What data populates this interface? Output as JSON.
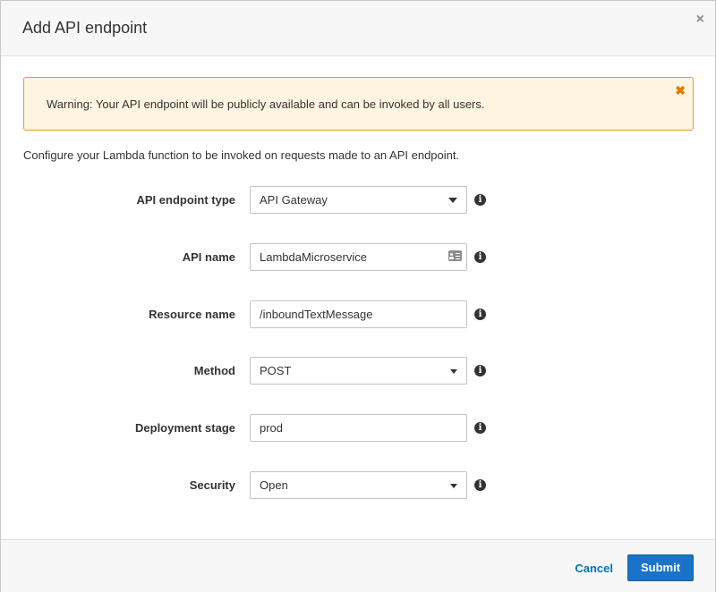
{
  "dialog": {
    "title": "Add API endpoint",
    "close_glyph": "×"
  },
  "alert": {
    "text": "Warning: Your API endpoint will be publicly available and can be invoked by all users.",
    "close_glyph": "✖"
  },
  "intro": "Configure your Lambda function to be invoked on requests made to an API endpoint.",
  "form": {
    "endpoint_type": {
      "label": "API endpoint type",
      "value": "API Gateway"
    },
    "api_name": {
      "label": "API name",
      "value": "LambdaMicroservice"
    },
    "resource_name": {
      "label": "Resource name",
      "value": "/inboundTextMessage"
    },
    "method": {
      "label": "Method",
      "value": "POST"
    },
    "deployment_stage": {
      "label": "Deployment stage",
      "value": "prod"
    },
    "security": {
      "label": "Security",
      "value": "Open"
    },
    "info_glyph": "i"
  },
  "footer": {
    "cancel_label": "Cancel",
    "submit_label": "Submit"
  },
  "colors": {
    "warning_border": "#eb9d1f",
    "warning_bg": "#fef4e1",
    "link": "#0073bb",
    "primary": "#1a73c8"
  }
}
